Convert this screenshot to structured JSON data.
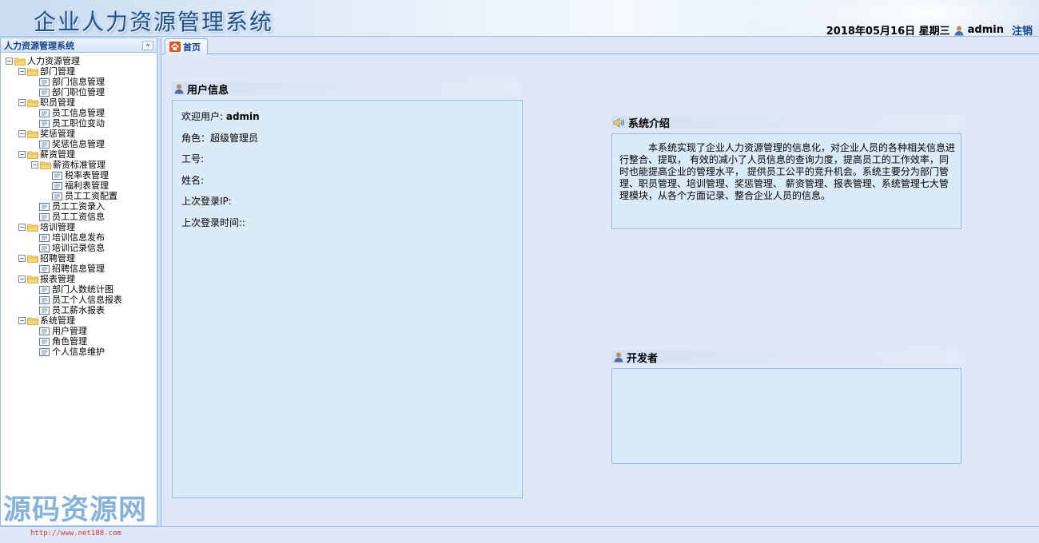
{
  "header": {
    "title": "企业人力资源管理系统",
    "date": "2018年05月16日 星期三",
    "username": "admin",
    "logout_label": "注销"
  },
  "sidebar": {
    "title": "人力资源管理系统",
    "collapse_glyph": "«",
    "tree": [
      {
        "label": "人力资源管理",
        "type": "folder",
        "level": 0
      },
      {
        "label": "部门管理",
        "type": "folder",
        "level": 1
      },
      {
        "label": "部门信息管理",
        "type": "leaf",
        "level": 2
      },
      {
        "label": "部门职位管理",
        "type": "leaf",
        "level": 2
      },
      {
        "label": "职员管理",
        "type": "folder",
        "level": 1
      },
      {
        "label": "员工信息管理",
        "type": "leaf",
        "level": 2
      },
      {
        "label": "员工职位变动",
        "type": "leaf",
        "level": 2
      },
      {
        "label": "奖惩管理",
        "type": "folder",
        "level": 1
      },
      {
        "label": "奖惩信息管理",
        "type": "leaf",
        "level": 2
      },
      {
        "label": "薪资管理",
        "type": "folder",
        "level": 1
      },
      {
        "label": "薪资标准管理",
        "type": "folder",
        "level": 2
      },
      {
        "label": "税率表管理",
        "type": "leaf",
        "level": 3
      },
      {
        "label": "福利表管理",
        "type": "leaf",
        "level": 3
      },
      {
        "label": "员工工资配置",
        "type": "leaf",
        "level": 3
      },
      {
        "label": "员工工资录入",
        "type": "leaf",
        "level": 2
      },
      {
        "label": "员工工资信息",
        "type": "leaf",
        "level": 2
      },
      {
        "label": "培训管理",
        "type": "folder",
        "level": 1
      },
      {
        "label": "培训信息发布",
        "type": "leaf",
        "level": 2
      },
      {
        "label": "培训记录信息",
        "type": "leaf",
        "level": 2
      },
      {
        "label": "招聘管理",
        "type": "folder",
        "level": 1
      },
      {
        "label": "招聘信息管理",
        "type": "leaf",
        "level": 2
      },
      {
        "label": "报表管理",
        "type": "folder",
        "level": 1
      },
      {
        "label": "部门人数统计图",
        "type": "leaf",
        "level": 2
      },
      {
        "label": "员工个人信息报表",
        "type": "leaf",
        "level": 2
      },
      {
        "label": "员工薪水报表",
        "type": "leaf",
        "level": 2
      },
      {
        "label": "系统管理",
        "type": "folder",
        "level": 1
      },
      {
        "label": "用户管理",
        "type": "leaf",
        "level": 2
      },
      {
        "label": "角色管理",
        "type": "leaf",
        "level": 2
      },
      {
        "label": "个人信息维护",
        "type": "leaf",
        "level": 2
      }
    ]
  },
  "tabs": [
    {
      "label": "首页"
    }
  ],
  "user_info": {
    "title": "用户信息",
    "welcome_label": "欢迎用户: ",
    "welcome_value": "admin",
    "role": "角色：超级管理员",
    "job_no": "工号:",
    "name": "姓名:",
    "last_ip": "上次登录IP:",
    "last_time": "上次登录时间::"
  },
  "system_intro": {
    "title": "系统介绍",
    "text": "本系统实现了企业人力资源管理的信息化，对企业人员的各种相关信息进行整合、提取， 有效的减小了人员信息的查询力度，提高员工的工作效率，同时也能提高企业的管理水平， 提供员工公平的竞升机会。系统主要分为部门管理、职员管理、培训管理、奖惩管理、 薪资管理、报表管理、系统管理七大管理模块，从各个方面记录、整合企业人员的信息。"
  },
  "developer": {
    "title": "开发者"
  },
  "watermark": {
    "text": "源码资源网",
    "url": "http://www.net188.com"
  },
  "colors": {
    "accent": "#15428b",
    "border": "#99bbe8",
    "panel_bg": "#dbeaf7",
    "page_bg": "#dfe8f6"
  }
}
